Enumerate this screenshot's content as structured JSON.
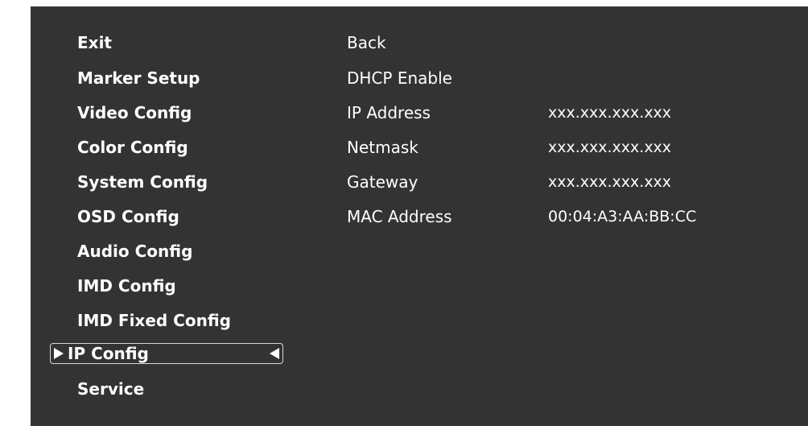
{
  "menu": {
    "items": [
      {
        "label": "Exit"
      },
      {
        "label": "Marker Setup"
      },
      {
        "label": "Video Config"
      },
      {
        "label": "Color Config"
      },
      {
        "label": "System Config"
      },
      {
        "label": "OSD Config"
      },
      {
        "label": "Audio Config"
      },
      {
        "label": "IMD Config"
      },
      {
        "label": "IMD Fixed Config"
      },
      {
        "label": "IP Config",
        "selected": true
      },
      {
        "label": "Service"
      }
    ]
  },
  "ip_config": {
    "rows": [
      {
        "label": "Back",
        "value": ""
      },
      {
        "label": "DHCP Enable",
        "value": ""
      },
      {
        "label": "IP Address",
        "value": "xxx.xxx.xxx.xxx"
      },
      {
        "label": "Netmask",
        "value": "xxx.xxx.xxx.xxx"
      },
      {
        "label": "Gateway",
        "value": "xxx.xxx.xxx.xxx"
      },
      {
        "label": "MAC Address",
        "value": "00:04:A3:AA:BB:CC"
      }
    ]
  },
  "colors": {
    "panel_bg": "#333333",
    "text": "#ffffff",
    "selection_border": "#d8d8d8"
  }
}
